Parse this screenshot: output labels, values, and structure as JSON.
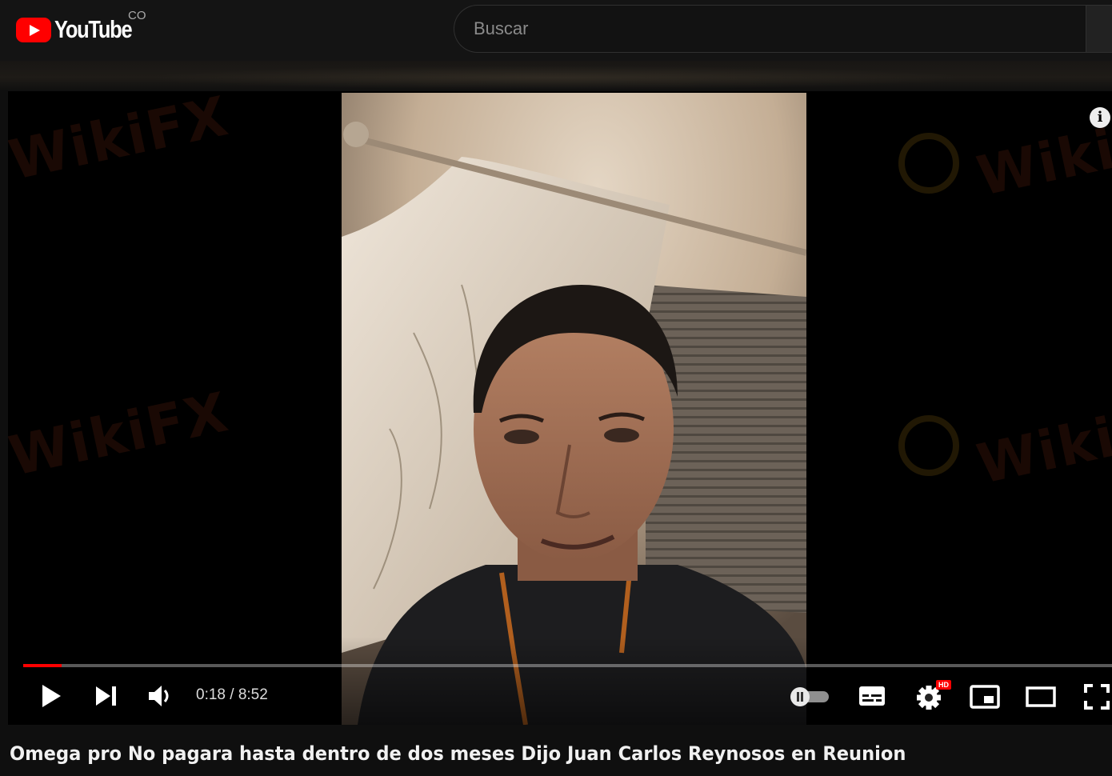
{
  "header": {
    "logo_text": "YouTube",
    "country_code": "CO",
    "search": {
      "placeholder": "Buscar",
      "value": ""
    }
  },
  "watermark": {
    "text": "WikiFX"
  },
  "player": {
    "current_time": "0:18",
    "duration": "8:52",
    "time_display": "0:18 / 8:52",
    "progress_fraction": 0.035,
    "settings_badge": "HD",
    "icons": [
      "play-icon",
      "next-icon",
      "volume-icon",
      "autoplay-toggle",
      "subtitles-icon",
      "settings-icon",
      "miniplayer-icon",
      "theater-icon",
      "fullscreen-icon",
      "info-icon"
    ],
    "accent_color": "#ff0000"
  },
  "video": {
    "title": "Omega pro No pagara hasta dentro de dos meses Dijo Juan Carlos Reynosos en Reunion"
  }
}
